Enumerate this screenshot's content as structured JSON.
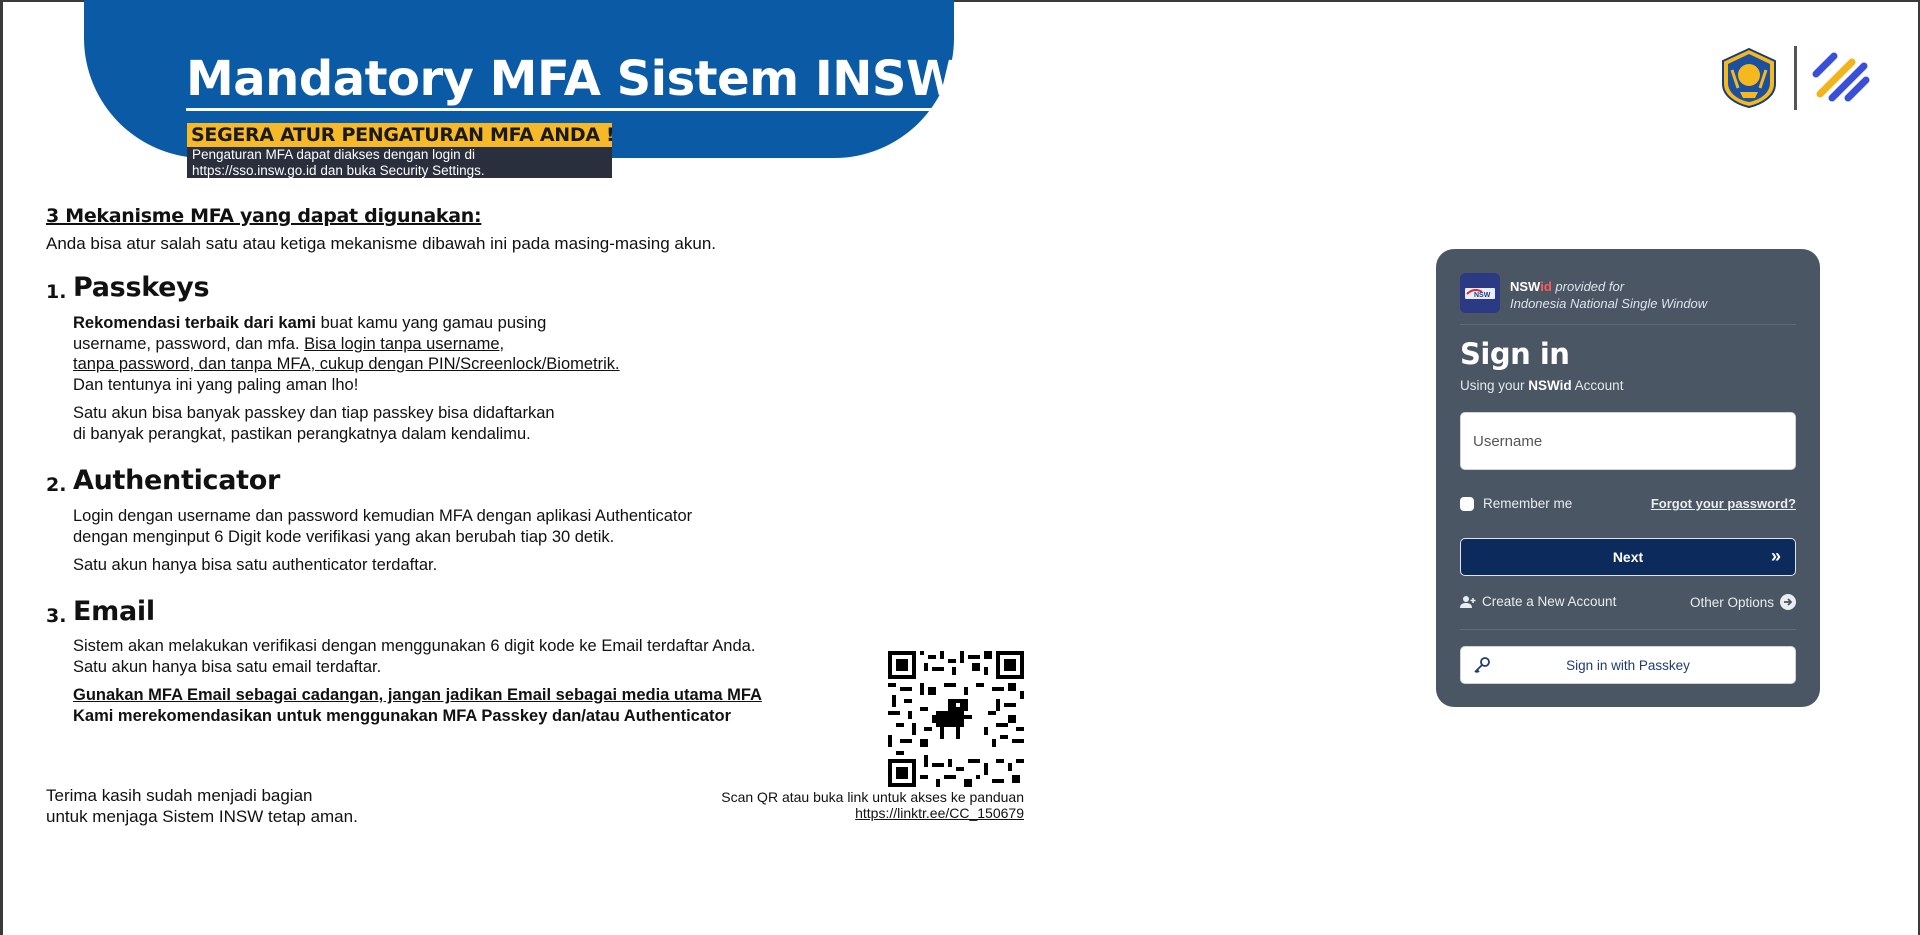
{
  "banner": {
    "title": "Mandatory MFA Sistem INSW",
    "highlight": "SEGERA ATUR PENGATURAN MFA ANDA !",
    "note_line1": "Pengaturan MFA dapat diakses dengan login di",
    "note_line2": "https://sso.insw.go.id dan buka Security Settings."
  },
  "intro": {
    "heading": "3 Mekanisme MFA yang dapat digunakan:",
    "text": "Anda bisa atur salah satu atau ketiga mekanisme dibawah ini pada masing-masing akun."
  },
  "mechanisms": [
    {
      "num": "1.",
      "title": "Passkeys",
      "bold_lead": "Rekomendasi terbaik dari kami",
      "line1_rest": " buat kamu yang gamau pusing",
      "line2_plain": "username, password, dan mfa. ",
      "line2_underline": "Bisa login tanpa username,",
      "line3_underline": "tanpa password, dan tanpa MFA, cukup dengan PIN/Screenlock/Biometrik.",
      "line4": "Dan tentunya ini yang paling aman lho!",
      "para2_line1": "Satu akun bisa banyak passkey dan tiap passkey bisa didaftarkan",
      "para2_line2": "di banyak perangkat, pastikan perangkatnya dalam kendalimu."
    },
    {
      "num": "2.",
      "title": "Authenticator",
      "line1": "Login dengan username dan password kemudian MFA dengan aplikasi Authenticator",
      "line2": "dengan menginput 6 Digit kode verifikasi yang akan berubah tiap 30 detik.",
      "line3": "Satu akun hanya bisa satu authenticator terdaftar."
    },
    {
      "num": "3.",
      "title": "Email",
      "line1": "Sistem akan melakukan verifikasi dengan menggunakan 6 digit kode ke Email terdaftar Anda.",
      "line2": "Satu akun hanya bisa satu email terdaftar.",
      "bold_underline": "Gunakan MFA Email sebagai cadangan, jangan jadikan Email sebagai media utama MFA",
      "bold": "Kami merekomendasikan untuk menggunakan MFA Passkey dan/atau Authenticator"
    }
  ],
  "qr": {
    "caption": "Scan QR atau buka link untuk akses ke panduan",
    "link": "https://linktr.ee/CC_150679"
  },
  "thanks": {
    "line1": "Terima kasih sudah menjadi bagian",
    "line2": "untuk menjaga Sistem INSW tetap aman."
  },
  "login": {
    "brand_nsw": "NSW",
    "brand_id": "id",
    "brand_provided": " provided for",
    "brand_line2": "Indonesia National Single Window",
    "title": "Sign in",
    "subtitle_pre": "Using your ",
    "subtitle_brand": "NSWid",
    "subtitle_post": " Account",
    "username_placeholder": "Username",
    "remember_label": "Remember me",
    "forgot_label": "Forgot your password?",
    "next_label": "Next",
    "create_label": "Create a New Account",
    "other_label": "Other Options",
    "passkey_label": "Sign in with Passkey"
  },
  "colors": {
    "banner_blue": "#0a5aa6",
    "highlight_yellow": "#f6b928",
    "card_bg": "#4a5663",
    "next_button": "#0d2a5c"
  },
  "icons": [
    "kemenkeu-logo",
    "insw-logo",
    "nsw-brand-logo",
    "qr-code",
    "add-user-icon",
    "arrow-right-circle-icon",
    "double-chevron-right-icon",
    "key-icon"
  ]
}
